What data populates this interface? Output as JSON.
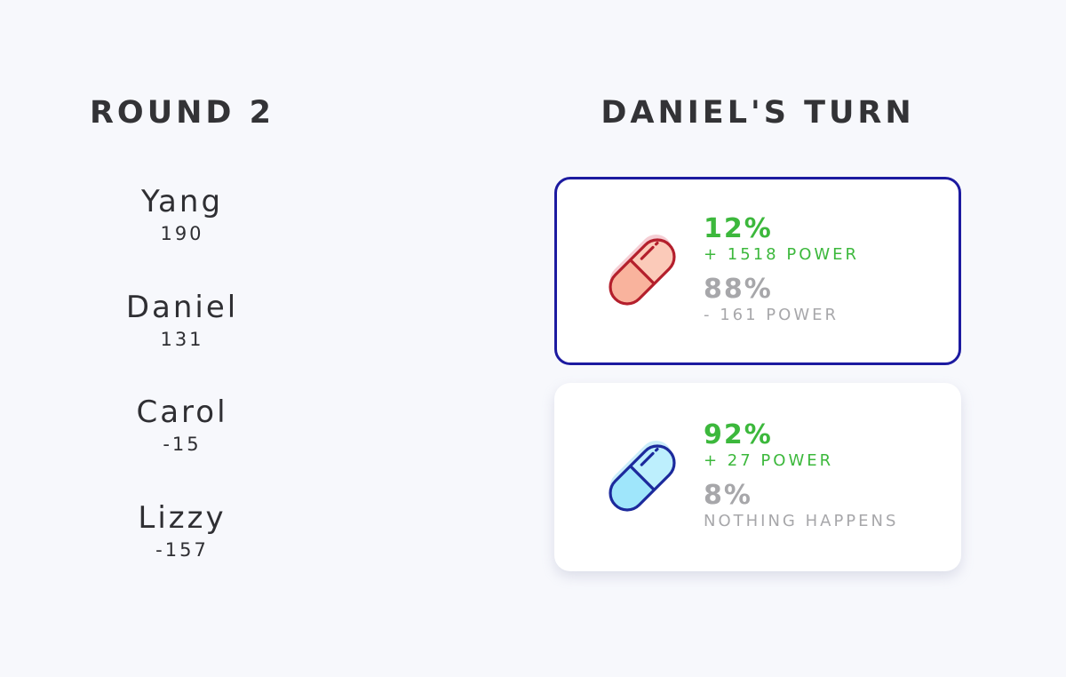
{
  "round": {
    "title": "ROUND 2"
  },
  "players": [
    {
      "name": "Yang",
      "score": "190"
    },
    {
      "name": "Daniel",
      "score": "131"
    },
    {
      "name": "Carol",
      "score": "-15"
    },
    {
      "name": "Lizzy",
      "score": "-157"
    }
  ],
  "turn": {
    "title": "DANIEL'S TURN"
  },
  "choices": [
    {
      "pill": "red-pill-icon",
      "selected": true,
      "good_chance": "12%",
      "good_effect": "+ 1518 POWER",
      "bad_chance": "88%",
      "bad_effect": "- 161 POWER",
      "colors": {
        "fill": "#f9b39d",
        "stroke": "#b41f2c",
        "border": "#1c1aa0"
      }
    },
    {
      "pill": "blue-pill-icon",
      "selected": false,
      "good_chance": "92%",
      "good_effect": "+ 27 POWER",
      "bad_chance": "8%",
      "bad_effect": "NOTHING HAPPENS",
      "colors": {
        "fill": "#9fe6fb",
        "stroke": "#1c2a9c"
      }
    }
  ],
  "colors": {
    "background": "#f7f8fc",
    "good": "#3cb83c",
    "bad": "#a7a7aa",
    "text": "#333336"
  }
}
